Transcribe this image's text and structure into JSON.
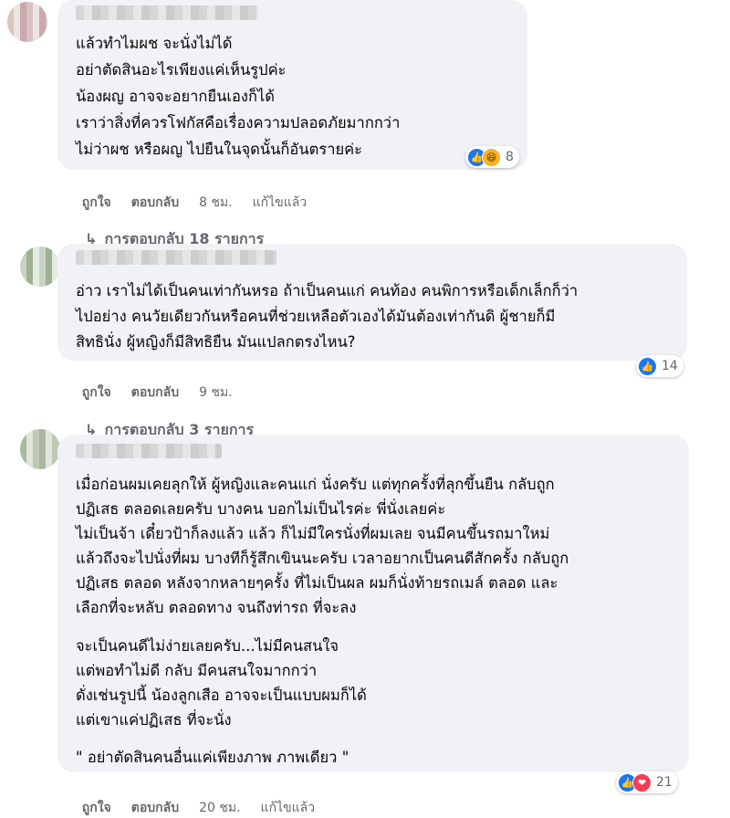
{
  "comments": [
    {
      "lines": [
        "แล้วทำไมผช จะนั่งไม่ได้",
        "อย่าตัดสินอะไรเพียงแค่เห็นรูปค่ะ",
        "น้องผญ อาจจะอยากยืนเองก็ได้",
        "เราว่าสิ่งที่ควรโฟกัสคือเรื่องความปลอดภัยมากกว่า",
        "ไม่ว่าผช หรือผญ ไปยืนในจุดนั้นก็อันตรายค่ะ"
      ],
      "reaction_icons": [
        "like-icon",
        "haha-icon"
      ],
      "reaction_count": "8",
      "like": "ถูกใจ",
      "reply": "ตอบกลับ",
      "time": "8 ชม.",
      "edited": "แก้ไขแล้ว",
      "replies_link": "การตอบกลับ 18 รายการ"
    },
    {
      "lines": [
        "อ่าว เราไม่ได้เป็นคนเท่ากันหรอ ถ้าเป็นคนแก่ คนท้อง คนพิการหรือเด็กเล็กก็ว่า",
        "ไปอย่าง คนวัยเดียวกันหรือคนที่ช่วยเหลือตัวเองได้มันต้องเท่ากันดิ ผู้ชายก็มี",
        "สิทธินั่ง ผู้หญิงก็มีสิทธิยืน มันแปลกตรงไหน?"
      ],
      "reaction_icons": [
        "like-icon"
      ],
      "reaction_count": "14",
      "like": "ถูกใจ",
      "reply": "ตอบกลับ",
      "time": "9 ชม.",
      "replies_link": "การตอบกลับ 3 รายการ"
    },
    {
      "lines": [
        "เมื่อก่อนผมเคยลุกให้ ผู้หญิงและคนแก่ นั่งครับ แต่ทุกครั้งที่ลุกขึ้นยืน กลับถูก",
        "ปฏิเสธ ตลอดเลยครับ บางคน บอกไม่เป็นไรค่ะ พี่นั่งเลยค่ะ",
        "ไม่เป็นจ้า เดี๋ยวป้าก็ลงแล้ว แล้ว ก็ไม่มีใครนั่งที่ผมเลย จนมีคนขึ้นรถมาใหม่",
        "แล้วถึงจะไปนั่งที่ผม บางทีก็รู้สึกเขินนะครับ เวลาอยากเป็นคนดีสักครั้ง กลับถูก",
        "ปฏิเสธ ตลอด หลังจากหลายๆครั้ง ที่ไม่เป็นผล ผมก็นั่งท้ายรถเมล์ ตลอด และ",
        "เลือกที่จะหลับ ตลอดทาง จนถึงท่ารถ ที่จะลง"
      ],
      "lines2": [
        "จะเป็นคนดีไม่ง่ายเลยครับ...ไม่มีคนสนใจ",
        "แต่พอทำไม่ดี กลับ มีคนสนใจมากกว่า",
        "ดั่งเช่นรูปนี้ น้องลูกเสือ อาจจะเป็นแบบผมก็ได้",
        "แต่เขาแค่ปฏิเสธ ที่จะนั่ง"
      ],
      "quote": "\" อย่าตัดสินคนอื่นแค่เพียงภาพ ภาพเดียว \"",
      "reaction_icons": [
        "like-icon",
        "love-icon"
      ],
      "reaction_count": "21",
      "like": "ถูกใจ",
      "reply": "ตอบกลับ",
      "time": "20 ชม.",
      "edited": "แก้ไขแล้ว"
    }
  ]
}
